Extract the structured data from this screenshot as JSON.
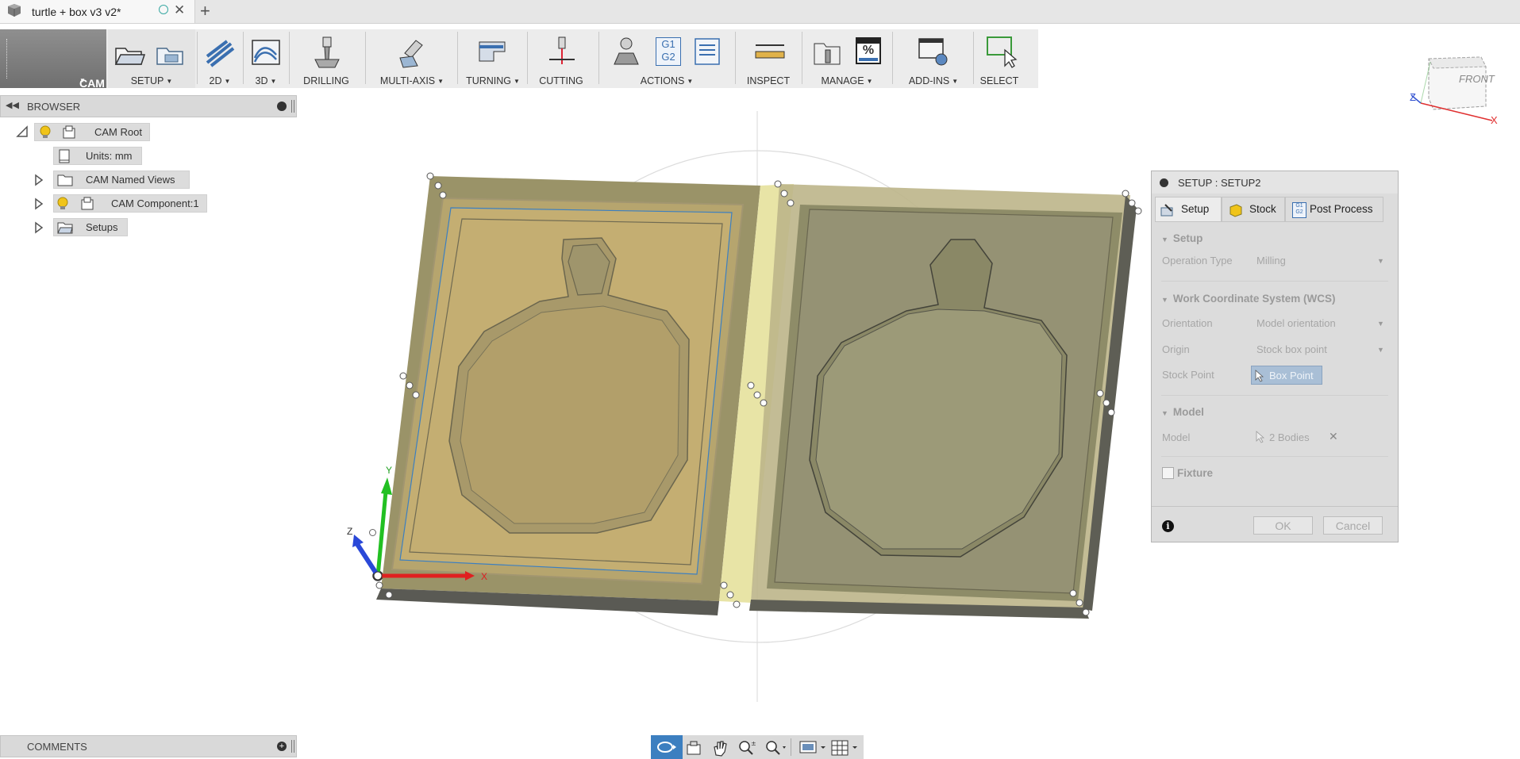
{
  "document": {
    "tab_title": "turtle + box v3 v2*",
    "add_tab": "+",
    "close_tab": "✕"
  },
  "toolbar": {
    "workspace": "CAM",
    "groups": [
      {
        "label": "SETUP"
      },
      {
        "label": "2D"
      },
      {
        "label": "3D"
      },
      {
        "label": "DRILLING"
      },
      {
        "label": "MULTI-AXIS"
      },
      {
        "label": "TURNING"
      },
      {
        "label": "CUTTING"
      },
      {
        "label": "ACTIONS"
      },
      {
        "label": "INSPECT"
      },
      {
        "label": "MANAGE"
      },
      {
        "label": "ADD-INS"
      },
      {
        "label": "SELECT"
      }
    ],
    "actions_g1g2_top": "G1",
    "actions_g1g2_bottom": "G2",
    "manage_percent": "%"
  },
  "browser": {
    "title": "BROWSER",
    "items": [
      {
        "label": "CAM Root"
      },
      {
        "label": "Units: mm"
      },
      {
        "label": "CAM Named Views"
      },
      {
        "label": "CAM Component:1"
      },
      {
        "label": "Setups"
      }
    ]
  },
  "comments": {
    "title": "COMMENTS"
  },
  "viewcube": {
    "face": "FRONT",
    "axis_z": "Z",
    "axis_x": "X"
  },
  "triad": {
    "z": "Z",
    "y": "Y",
    "x": "X"
  },
  "dialog": {
    "title": "SETUP : SETUP2",
    "tabs": [
      {
        "label": "Setup"
      },
      {
        "label": "Stock"
      },
      {
        "label": "Post Process"
      }
    ],
    "postprocess_icon_top": "G1",
    "postprocess_icon_bottom": "G2",
    "sections": {
      "setup": "Setup",
      "wcs": "Work Coordinate System (WCS)",
      "model": "Model"
    },
    "fields": {
      "operation_type_label": "Operation Type",
      "operation_type_value": "Milling",
      "orientation_label": "Orientation",
      "orientation_value": "Model orientation",
      "origin_label": "Origin",
      "origin_value": "Stock box point",
      "stock_point_label": "Stock Point",
      "stock_point_value": "Box Point",
      "model_label": "Model",
      "model_value": "2 Bodies",
      "model_clear": "✕",
      "fixture_label": "Fixture"
    },
    "info": "i",
    "ok": "OK",
    "cancel": "Cancel"
  },
  "colors": {
    "accent_blue": "#3c8dc5",
    "stock_tan": "#c9b98a",
    "model_olive": "#8a8a66"
  }
}
